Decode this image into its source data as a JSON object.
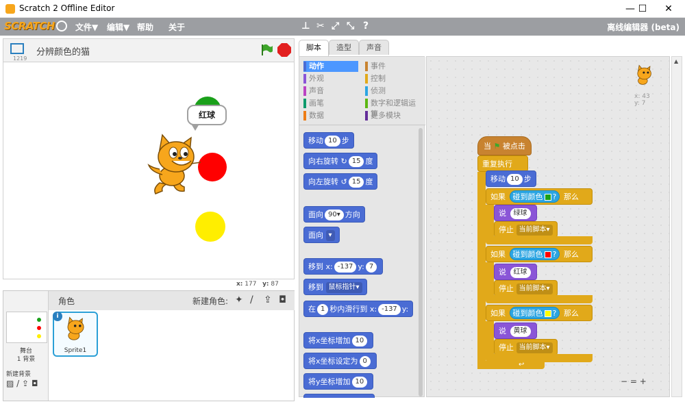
{
  "window": {
    "title": "Scratch 2 Offline Editor",
    "controls": [
      "—",
      "☐",
      "✕"
    ]
  },
  "menubar": {
    "logo": "SCRATCH",
    "file": "文件▼",
    "edit": "编辑▼",
    "help": "帮助",
    "about": "关于",
    "offline_label": "离线编辑器 (beta)"
  },
  "stage": {
    "version": "1219",
    "project_title": "分辨颜色的猫",
    "speech": "红球",
    "mouse_x_label": "x:",
    "mouse_x": "177",
    "mouse_y_label": "y:",
    "mouse_y": "87"
  },
  "sprite_pane": {
    "header": "角色",
    "new_sprite_label": "新建角色:",
    "stage_label": "舞台",
    "backdrop_count": "1 背景",
    "new_backdrop_label": "新建背景",
    "sprite_name": "Sprite1"
  },
  "tabs": [
    "脚本",
    "造型",
    "声音"
  ],
  "categories": [
    {
      "label": "动作",
      "color": "#4a6cd4"
    },
    {
      "label": "事件",
      "color": "#c88330"
    },
    {
      "label": "外观",
      "color": "#8a55d7"
    },
    {
      "label": "控制",
      "color": "#e1a91a"
    },
    {
      "label": "声音",
      "color": "#bb42c3"
    },
    {
      "label": "侦测",
      "color": "#2ca5e2"
    },
    {
      "label": "画笔",
      "color": "#0e9a6c"
    },
    {
      "label": "数字和逻辑运算",
      "color": "#5cb712"
    },
    {
      "label": "数据",
      "color": "#ee7d16"
    },
    {
      "label": "更多模块",
      "color": "#632d99"
    }
  ],
  "palette": {
    "move": {
      "text": "移动",
      "value": "10",
      "suffix": "步"
    },
    "turn_right": {
      "text": "向右旋转",
      "value": "15",
      "suffix": "度"
    },
    "turn_left": {
      "text": "向左旋转",
      "value": "15",
      "suffix": "度"
    },
    "point_dir": {
      "text": "面向",
      "value": "90▾",
      "suffix": "方向"
    },
    "point_towards": {
      "text": "面向",
      "value": "▾"
    },
    "goto_xy": {
      "text": "移到 x:",
      "x": "-137",
      "y_label": "y:",
      "y": "7"
    },
    "goto": {
      "text": "移到",
      "value": "鼠标指针▾"
    },
    "glide": {
      "prefix": "在",
      "secs": "1",
      "text": "秒内滑行到 x:",
      "x": "-137",
      "y_label": "y:"
    },
    "change_x": {
      "text": "将x坐标增加",
      "value": "10"
    },
    "set_x": {
      "text": "将x坐标设定为",
      "value": "0"
    },
    "change_y": {
      "text": "将y坐标增加",
      "value": "10"
    }
  },
  "script": {
    "hat_when": "当",
    "hat_clicked": "被点击",
    "forever": "重复执行",
    "move": "移动",
    "move_value": "10",
    "move_suffix": "步",
    "if_label": "如果",
    "touching": "碰到颜色",
    "question": "?",
    "then": "那么",
    "say": "说",
    "stop": "停止",
    "stop_option": "当前脚本▾",
    "green_text": "绿球",
    "red_text": "红球",
    "yellow_text": "黄球",
    "green_color": "#1aa01a",
    "red_color": "#ff0000",
    "yellow_color": "#ffff00"
  },
  "sprite_info": {
    "x_label": "x:",
    "x": "43",
    "y_label": "y:",
    "y": "7"
  },
  "zoom": [
    "−",
    "=",
    "+"
  ]
}
